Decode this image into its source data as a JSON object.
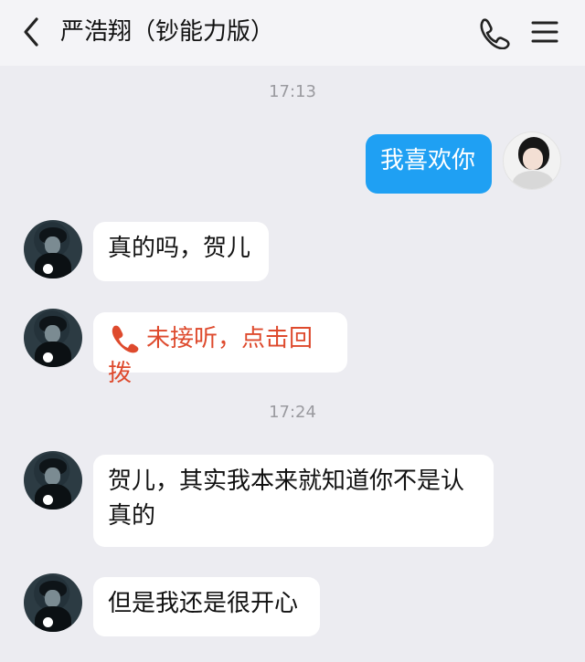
{
  "header": {
    "title": "严浩翔（钞能力版）"
  },
  "icons": {
    "back": "chevron-left-icon",
    "phone": "phone-icon",
    "menu": "menu-icon",
    "missed_call": "missed-call-icon"
  },
  "colors": {
    "outgoing_bubble": "#1fa0f3",
    "incoming_bubble": "#ffffff",
    "missed_call_text": "#de4a2d",
    "background": "#ececf1"
  },
  "messages": {
    "time_1": "17:13",
    "m1": {
      "sender": "me",
      "text": "我喜欢你"
    },
    "m2": {
      "sender": "contact",
      "text": "真的吗，贺儿"
    },
    "m3": {
      "sender": "contact",
      "text": "未接听，点击回拨"
    },
    "time_2": "17:24",
    "m4": {
      "sender": "contact",
      "text": "贺儿，其实我本来就知道你不是认真的"
    },
    "m5": {
      "sender": "contact",
      "text": "但是我还是很开心"
    }
  }
}
